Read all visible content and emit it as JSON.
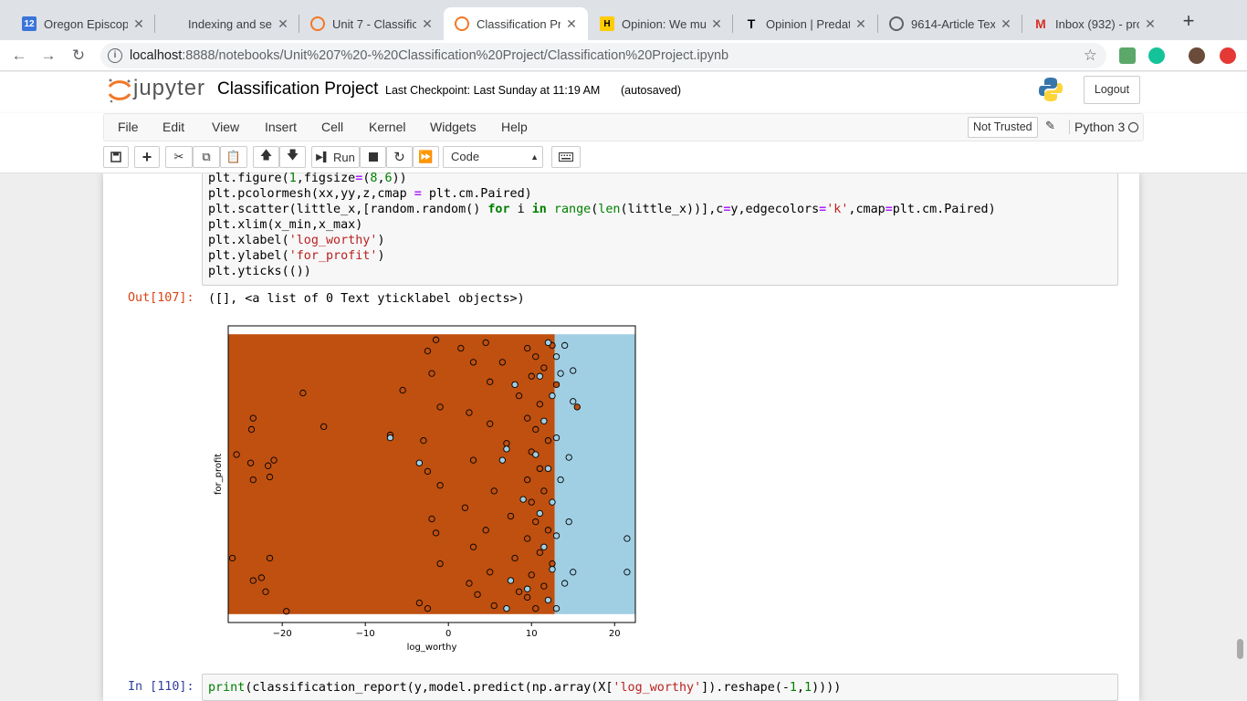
{
  "browser": {
    "tabs": [
      {
        "title": "Oregon Episcopa",
        "favicon": "calendar-12-icon",
        "fav_text": "12",
        "color": "#3b74db"
      },
      {
        "title": "Indexing and sele",
        "favicon": "tableau-icon",
        "fav_text": "",
        "color": "#1f77b4"
      },
      {
        "title": "Unit 7 - Classific",
        "favicon": "jupyter-icon",
        "fav_text": "",
        "color": "#f37726"
      },
      {
        "title": "Classification Pr",
        "favicon": "notebook-icon",
        "fav_text": "",
        "color": "#f37726",
        "active": true
      },
      {
        "title": "Opinion: We mus",
        "favicon": "h-icon",
        "fav_text": "H",
        "color": "#ffcc00"
      },
      {
        "title": "Opinion | Predat",
        "favicon": "nyt-icon",
        "fav_text": "T",
        "color": "#000000"
      },
      {
        "title": "9614-Article Tex",
        "favicon": "globe-icon",
        "fav_text": "",
        "color": "#5f6368"
      },
      {
        "title": "Inbox (932) - pro",
        "favicon": "gmail-icon",
        "fav_text": "M",
        "color": "#d93025"
      }
    ],
    "url_host": "localhost",
    "url_rest": ":8888/notebooks/Unit%207%20-%20Classification%20Project/Classification%20Project.ipynb"
  },
  "jupyter": {
    "logo_text": "jupyter",
    "notebook_name": "Classification Project",
    "checkpoint": "Last Checkpoint: Last Sunday at 11:19 AM",
    "autosave": "(autosaved)",
    "logout": "Logout",
    "menus": [
      "File",
      "Edit",
      "View",
      "Insert",
      "Cell",
      "Kernel",
      "Widgets",
      "Help"
    ],
    "not_trusted": "Not Trusted",
    "kernel": "Python 3",
    "run_label": "Run",
    "cell_type": "Code"
  },
  "cells": {
    "out_prompt": "Out[107]:",
    "out_text": "([], <a list of 0 Text yticklabel objects>)",
    "in_prompt": "In [110]:"
  },
  "chart_data": {
    "type": "scatter",
    "title": "",
    "xlabel": "log_worthy",
    "ylabel": "for_profit",
    "xlim": [
      -26.5,
      22.5
    ],
    "ylim": [
      -0.03,
      1.03
    ],
    "xticks": [
      -20,
      -10,
      0,
      10,
      20
    ],
    "yticks": [],
    "background_regions": [
      {
        "x_from": -26.5,
        "x_to": 12.8,
        "color": "#bf5010"
      },
      {
        "x_from": 12.8,
        "x_to": 22.5,
        "color": "#a0cfe4"
      }
    ],
    "series": [
      {
        "color": "#bf5010",
        "points": [
          [
            -23.5,
            0.7
          ],
          [
            -23.7,
            0.66
          ],
          [
            -25.5,
            0.57
          ],
          [
            -23.8,
            0.54
          ],
          [
            -21.7,
            0.53
          ],
          [
            -21.5,
            0.49
          ],
          [
            -23.5,
            0.48
          ],
          [
            -21.0,
            0.55
          ],
          [
            -26.0,
            0.2
          ],
          [
            -21.5,
            0.2
          ],
          [
            -23.5,
            0.12
          ],
          [
            -22.5,
            0.13
          ],
          [
            -22.0,
            0.08
          ],
          [
            -19.5,
            0.01
          ],
          [
            -17.5,
            0.79
          ],
          [
            -15.0,
            0.67
          ],
          [
            -7.0,
            0.64
          ],
          [
            -5.5,
            0.8
          ],
          [
            -2.5,
            0.94
          ],
          [
            -1.5,
            0.98
          ],
          [
            -2.0,
            0.86
          ],
          [
            -1.0,
            0.74
          ],
          [
            -3.0,
            0.62
          ],
          [
            -2.5,
            0.51
          ],
          [
            -1.0,
            0.46
          ],
          [
            -2.0,
            0.34
          ],
          [
            -1.5,
            0.29
          ],
          [
            -3.5,
            0.04
          ],
          [
            -2.5,
            0.02
          ],
          [
            -1.0,
            0.18
          ],
          [
            1.5,
            0.95
          ],
          [
            3.0,
            0.9
          ],
          [
            2.5,
            0.72
          ],
          [
            3.0,
            0.55
          ],
          [
            2.0,
            0.38
          ],
          [
            3.0,
            0.24
          ],
          [
            2.5,
            0.11
          ],
          [
            3.5,
            0.07
          ],
          [
            4.5,
            0.97
          ],
          [
            5.0,
            0.83
          ],
          [
            5.0,
            0.68
          ],
          [
            5.5,
            0.44
          ],
          [
            4.5,
            0.3
          ],
          [
            5.0,
            0.15
          ],
          [
            5.5,
            0.03
          ],
          [
            6.5,
            0.9
          ],
          [
            7.0,
            0.61
          ],
          [
            7.5,
            0.35
          ],
          [
            8.0,
            0.2
          ],
          [
            8.5,
            0.78
          ],
          [
            8.5,
            0.08
          ],
          [
            9.5,
            0.95
          ],
          [
            9.5,
            0.7
          ],
          [
            9.5,
            0.48
          ],
          [
            9.5,
            0.27
          ],
          [
            9.5,
            0.06
          ],
          [
            10.0,
            0.85
          ],
          [
            10.0,
            0.58
          ],
          [
            10.0,
            0.4
          ],
          [
            10.0,
            0.14
          ],
          [
            10.5,
            0.92
          ],
          [
            10.5,
            0.66
          ],
          [
            10.5,
            0.33
          ],
          [
            10.5,
            0.02
          ],
          [
            11.0,
            0.75
          ],
          [
            11.0,
            0.52
          ],
          [
            11.0,
            0.22
          ],
          [
            11.5,
            0.88
          ],
          [
            11.5,
            0.44
          ],
          [
            11.5,
            0.1
          ],
          [
            12.0,
            0.62
          ],
          [
            12.0,
            0.3
          ],
          [
            12.5,
            0.96
          ],
          [
            12.5,
            0.18
          ],
          [
            13.0,
            0.82
          ],
          [
            15.5,
            0.74
          ]
        ]
      },
      {
        "color": "#a0cfe4",
        "points": [
          [
            -7.0,
            0.63
          ],
          [
            -3.5,
            0.54
          ],
          [
            6.5,
            0.55
          ],
          [
            7.0,
            0.59
          ],
          [
            7.5,
            0.12
          ],
          [
            7.0,
            0.02
          ],
          [
            8.0,
            0.82
          ],
          [
            9.0,
            0.41
          ],
          [
            9.5,
            0.09
          ],
          [
            10.5,
            0.57
          ],
          [
            11.0,
            0.85
          ],
          [
            11.0,
            0.36
          ],
          [
            11.5,
            0.69
          ],
          [
            11.5,
            0.24
          ],
          [
            12.0,
            0.97
          ],
          [
            12.0,
            0.52
          ],
          [
            12.0,
            0.05
          ],
          [
            12.5,
            0.78
          ],
          [
            12.5,
            0.4
          ],
          [
            12.5,
            0.16
          ],
          [
            13.0,
            0.92
          ],
          [
            13.0,
            0.63
          ],
          [
            13.0,
            0.28
          ],
          [
            13.0,
            0.02
          ],
          [
            13.5,
            0.86
          ],
          [
            13.5,
            0.48
          ],
          [
            14.0,
            0.96
          ],
          [
            14.0,
            0.11
          ],
          [
            14.5,
            0.56
          ],
          [
            15.0,
            0.87
          ],
          [
            15.0,
            0.76
          ],
          [
            15.0,
            0.15
          ],
          [
            14.5,
            0.33
          ],
          [
            21.5,
            0.15
          ],
          [
            21.5,
            0.27
          ]
        ]
      }
    ]
  },
  "code": {
    "line1": "plt.figure(1,figsize=(8,6))",
    "line2": "plt.pcolormesh(xx,yy,z,cmap = plt.cm.Paired)",
    "line3": "plt.scatter(little_x,[random.random() for i in range(len(little_x))],c=y,edgecolors='k',cmap=plt.cm.Paired)",
    "line4": "plt.xlim(x_min,x_max)",
    "line5": "plt.xlabel('log_worthy')",
    "line6": "plt.ylabel('for_profit')",
    "line7": "plt.yticks(())",
    "in110": "print(classification_report(y,model.predict(np.array(X['log_worthy']).reshape(-1,1))))"
  }
}
